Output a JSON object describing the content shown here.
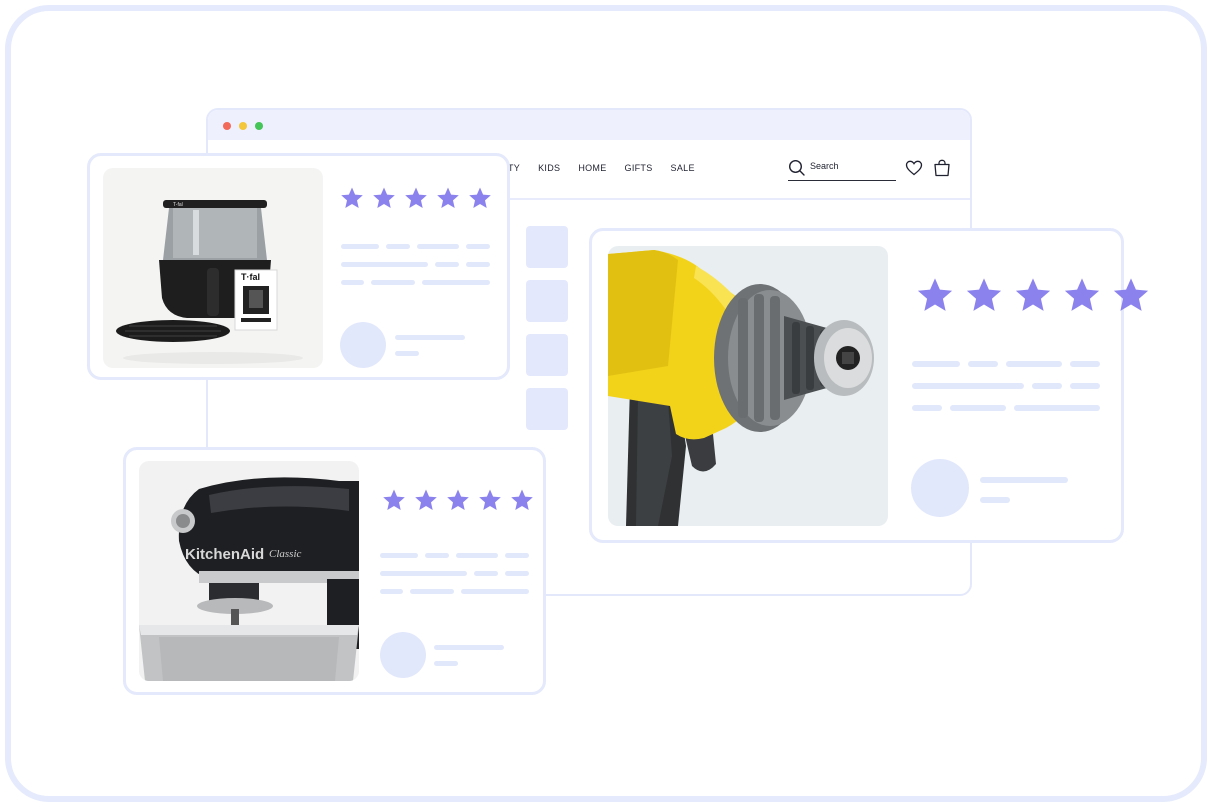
{
  "nav": {
    "links": [
      "TY",
      "KIDS",
      "HOME",
      "GIFTS",
      "SALE"
    ],
    "search_placeholder": "Search"
  },
  "products": [
    {
      "name": "air-fryer",
      "brand_mark": "T-fal",
      "rating": 5
    },
    {
      "name": "cordless-drill",
      "rating": 5
    },
    {
      "name": "stand-mixer",
      "brand_mark": "KitchenAid",
      "model_mark": "Classic",
      "rating": 5
    }
  ],
  "colors": {
    "star": "#8b82ee",
    "placeholder": "#e2e8fb",
    "border": "#e4e9fb",
    "drill_yellow": "#f3d21a"
  }
}
